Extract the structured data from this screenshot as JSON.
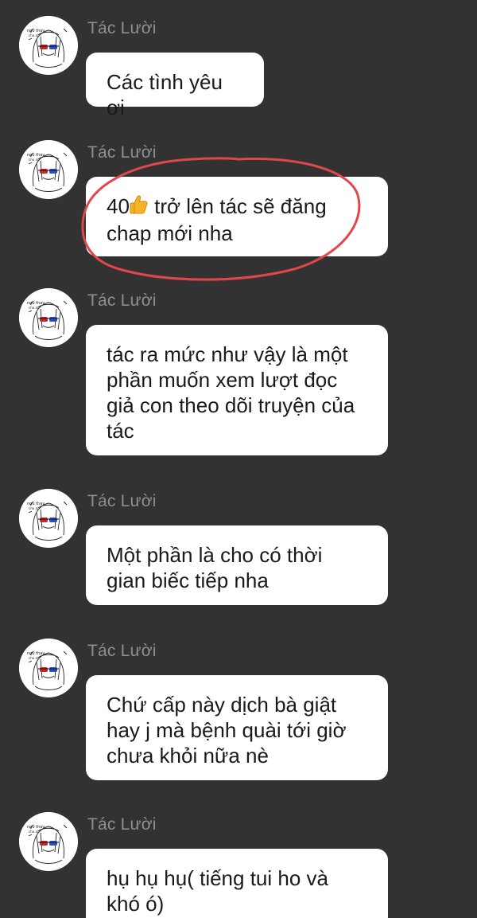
{
  "chat": {
    "messages": [
      {
        "sender": "Tác Lười",
        "text": "Các tình yêu ơi"
      },
      {
        "sender": "Tác Lười",
        "text_pre": "40",
        "emoji": "thumbs-up-icon",
        "text_post": " trở lên tác sẽ đăng\nchap mới nha",
        "highlighted": true
      },
      {
        "sender": "Tác Lười",
        "text": "tác ra mức như vậy là một\nphần muốn xem lượt đọc\ngiả con theo dõi truyện của\ntác"
      },
      {
        "sender": "Tác Lười",
        "text": "Một phần là cho có thời\ngian biếc tiếp nha"
      },
      {
        "sender": "Tác Lười",
        "text": "Chứ cấp này dịch bà giật\nhay j mà bệnh quài tới giờ\nchưa khỏi nữa nè"
      },
      {
        "sender": "Tác Lười",
        "text": "hụ hụ hụ( tiếng tui ho và\nkhó ó)"
      }
    ]
  },
  "colors": {
    "background": "#323232",
    "bubble": "#ffffff",
    "sender_name": "#8f8f8f",
    "highlight_ring": "#e0474c"
  }
}
